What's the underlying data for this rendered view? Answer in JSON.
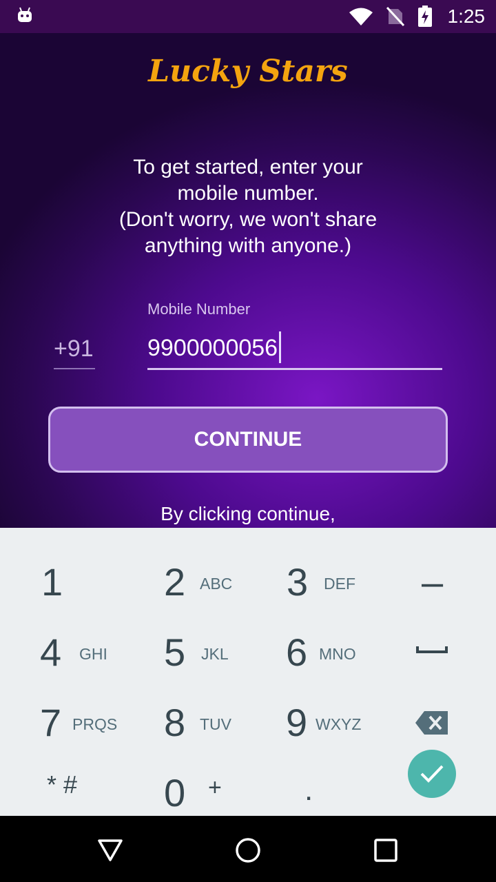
{
  "status_bar": {
    "time": "1:25",
    "icons": [
      "android-debug-icon",
      "wifi-icon",
      "no-sim-icon",
      "battery-charging-icon"
    ]
  },
  "app": {
    "logo": "Lucky Stars",
    "intro_lines": [
      "To get started, enter your",
      "mobile number.",
      "(Don't worry, we won't share",
      "anything with anyone.)"
    ],
    "country_code": "+91",
    "mobile_label": "Mobile Number",
    "mobile_value": "9900000056",
    "continue_label": "CONTINUE",
    "terms_text": "By clicking continue,"
  },
  "keypad": {
    "keys": [
      {
        "num": "1",
        "letters": ""
      },
      {
        "num": "2",
        "letters": "ABC"
      },
      {
        "num": "3",
        "letters": "DEF"
      },
      {
        "num": "–",
        "letters": ""
      },
      {
        "num": "4",
        "letters": "GHI"
      },
      {
        "num": "5",
        "letters": "JKL"
      },
      {
        "num": "6",
        "letters": "MNO"
      },
      {
        "num": "7",
        "letters": "PRQS"
      },
      {
        "num": "8",
        "letters": "TUV"
      },
      {
        "num": "9",
        "letters": "WXYZ"
      },
      {
        "num": "* #",
        "letters": ""
      },
      {
        "num": "0",
        "letters": "+"
      },
      {
        "num": ".",
        "letters": ""
      }
    ]
  },
  "colors": {
    "accent_logo": "#f4a40f",
    "button_bg": "#8650bd",
    "done_button": "#4db6ac"
  }
}
